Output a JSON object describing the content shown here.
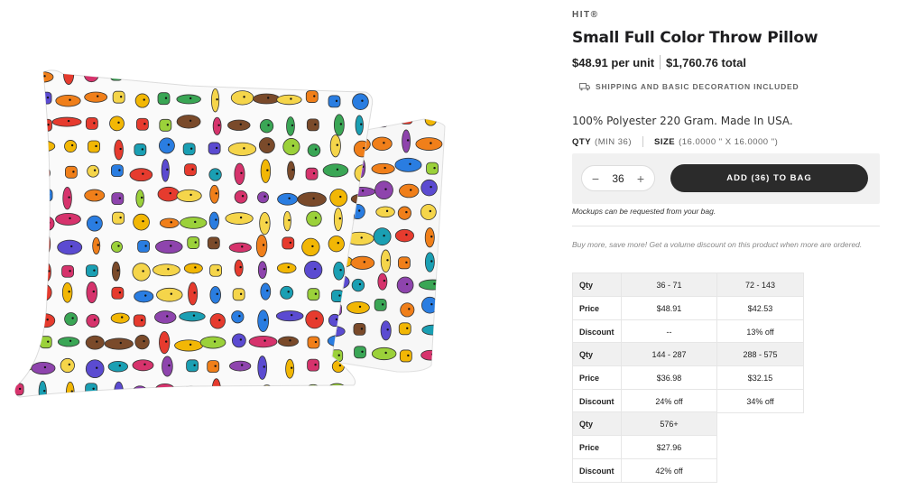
{
  "product": {
    "brand": "HIT®",
    "title": "Small Full Color Throw Pillow",
    "unit_price": "$48.91 per unit",
    "total_price": "$1,760.76 total",
    "shipping_note": "SHIPPING AND BASIC DECORATION INCLUDED",
    "description": "100% Polyester 220 Gram. Made In USA.",
    "image_alt": "Two throw pillows printed with colorful cartoon microbes"
  },
  "options": {
    "qty_label": "QTY",
    "qty_min": "(MIN 36)",
    "size_label": "SIZE",
    "size_value": "(16.0000 \" X 16.0000 \")"
  },
  "cart": {
    "quantity": "36",
    "minus": "−",
    "plus": "+",
    "add_label": "ADD (36) TO BAG",
    "mockup_note": "Mockups can be requested from your bag."
  },
  "volume": {
    "note": "Buy more, save more! Get a volume discount on this product when more are ordered.",
    "labels": {
      "qty": "Qty",
      "price": "Price",
      "discount": "Discount"
    },
    "tiers": [
      {
        "range": "36 - 71",
        "price": "$48.91",
        "discount": "--"
      },
      {
        "range": "72 - 143",
        "price": "$42.53",
        "discount": "13% off"
      },
      {
        "range": "144 - 287",
        "price": "$36.98",
        "discount": "24% off"
      },
      {
        "range": "288 - 575",
        "price": "$32.15",
        "discount": "34% off"
      },
      {
        "range": "576+",
        "price": "$27.96",
        "discount": "42% off"
      }
    ]
  },
  "colors": {
    "button_dark": "#2b2b2b",
    "panel_bg": "#f1f1f1",
    "header_cell_bg": "#f0f0f0"
  }
}
